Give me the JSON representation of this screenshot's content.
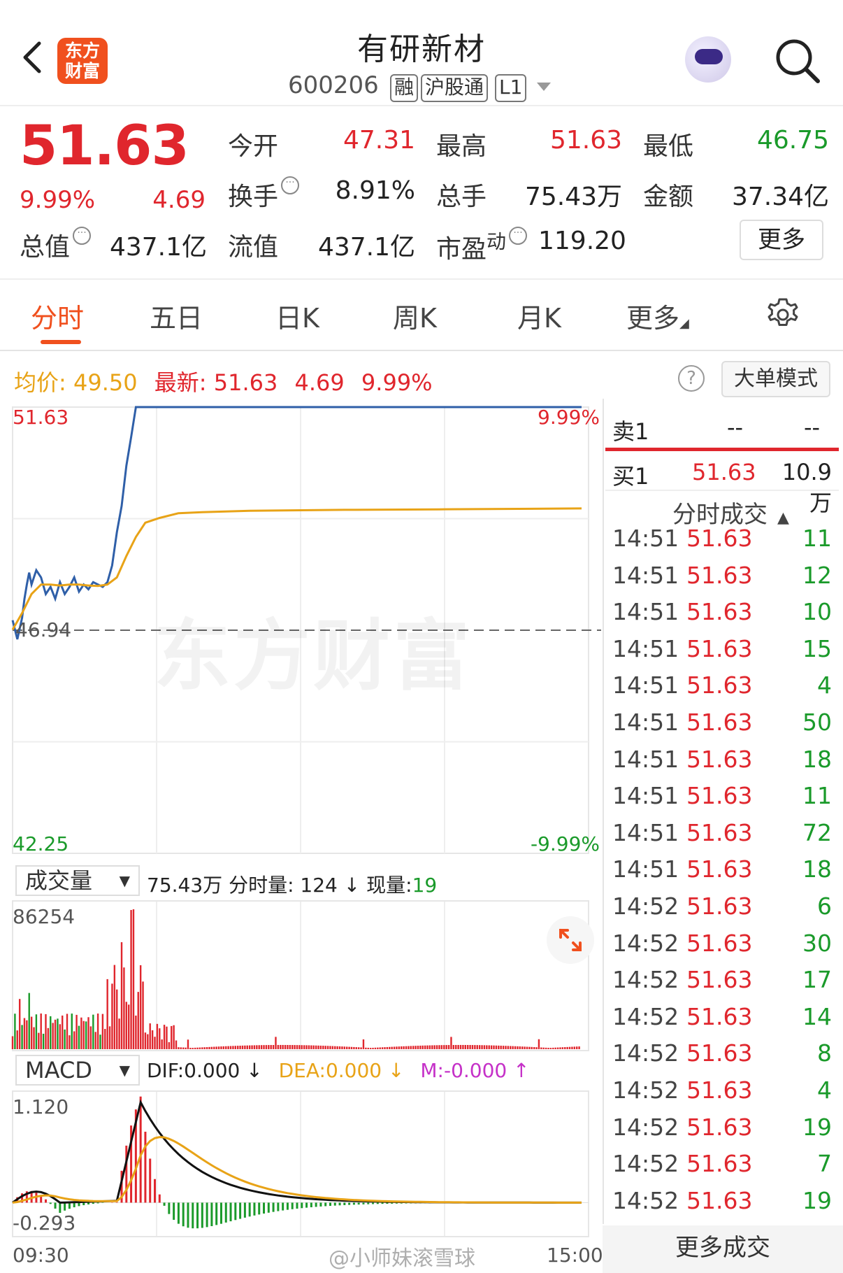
{
  "header": {
    "logo_line1": "东方",
    "logo_line2": "财富",
    "title": "有研新材",
    "code": "600206",
    "tags": [
      "融",
      "沪股通",
      "L1"
    ]
  },
  "quote": {
    "price": "51.63",
    "pct": "9.99%",
    "change": "4.69",
    "rows": [
      [
        {
          "label": "今开",
          "value": "47.31",
          "color": "red"
        },
        {
          "label": "最高",
          "value": "51.63",
          "color": "red"
        },
        {
          "label": "最低",
          "value": "46.75",
          "color": "green"
        }
      ],
      [
        {
          "label": "换手",
          "value": "8.91%",
          "color": "black"
        },
        {
          "label": "总手",
          "value": "75.43万",
          "color": "black"
        },
        {
          "label": "金额",
          "value": "37.34亿",
          "color": "black"
        }
      ],
      [
        {
          "label": "流值",
          "value": "437.1亿",
          "color": "black"
        },
        {
          "label": "市盈",
          "value": "119.20",
          "color": "black"
        }
      ]
    ],
    "total_value_label": "总值",
    "total_value": "437.1亿",
    "pe_sup": "动",
    "more_button": "更多"
  },
  "tabs": [
    "分时",
    "五日",
    "日K",
    "周K",
    "月K",
    "更多"
  ],
  "info": {
    "avg_label": "均价:",
    "avg_value": "49.50",
    "latest_label": "最新:",
    "latest_value": "51.63",
    "latest_change": "4.69",
    "latest_pct": "9.99%",
    "help": "?",
    "big_order_mode": "大单模式"
  },
  "chart_labels": {
    "price_high": "51.63",
    "pct_high": "9.99%",
    "pre_close": "46.94",
    "price_low": "42.25",
    "pct_low": "-9.99%",
    "volume_selector": "成交量",
    "volume_total": "75.43万",
    "min_vol_label": "分时量:",
    "min_vol_value": "124",
    "cur_vol_label": "现量:",
    "cur_vol_value": "19",
    "vol_max": "86254",
    "macd_selector": "MACD",
    "dif": "DIF:0.000",
    "dea": "DEA:0.000",
    "m": "M:-0.000",
    "macd_max": "1.120",
    "macd_min": "-0.293",
    "time_start": "09:30",
    "time_end": "15:00",
    "watermark": "东方财富",
    "credit": "@小师妹滚雪球"
  },
  "chart_data": {
    "type": "line",
    "title": "",
    "ylim": [
      42.25,
      51.63
    ],
    "pre_close": 46.94,
    "x_range": [
      "09:30",
      "15:00"
    ],
    "series": [
      {
        "name": "最新",
        "color": "#2f5fa8",
        "x": [
          0,
          2,
          4,
          5,
          6,
          7,
          8,
          10,
          12,
          14,
          16,
          18,
          20,
          22,
          24,
          26,
          28,
          30,
          32,
          34,
          36,
          38,
          40,
          42,
          44,
          46,
          48,
          50,
          52,
          60,
          120,
          180,
          240
        ],
        "y": [
          47.15,
          46.75,
          47.2,
          47.6,
          47.9,
          48.15,
          47.9,
          48.2,
          48.05,
          47.7,
          47.85,
          47.6,
          47.95,
          47.7,
          47.85,
          48.05,
          47.75,
          47.9,
          47.8,
          47.95,
          47.9,
          47.85,
          47.95,
          48.3,
          49.0,
          49.55,
          50.4,
          51.0,
          51.63,
          51.63,
          51.63,
          51.63,
          51.63
        ]
      },
      {
        "name": "均价",
        "color": "#e8a317",
        "x": [
          0,
          4,
          8,
          12,
          16,
          20,
          24,
          28,
          32,
          36,
          40,
          44,
          48,
          52,
          56,
          62,
          70,
          80,
          100,
          140,
          180,
          240
        ],
        "y": [
          46.95,
          47.3,
          47.7,
          47.9,
          47.9,
          47.88,
          47.9,
          47.9,
          47.88,
          47.87,
          47.9,
          48.05,
          48.5,
          48.9,
          49.2,
          49.3,
          49.4,
          49.42,
          49.45,
          49.47,
          49.48,
          49.5
        ]
      }
    ],
    "volume_max": 86254,
    "macd_range": [
      -0.293,
      1.12
    ]
  },
  "right_panel": {
    "sell1_label": "卖1",
    "sell1_price": "--",
    "sell1_vol": "--",
    "buy1_label": "买1",
    "buy1_price": "51.63",
    "buy1_vol": "10.9万",
    "trades_title": "分时成交",
    "trades": [
      {
        "time": "14:51",
        "price": "51.63",
        "vol": "11"
      },
      {
        "time": "14:51",
        "price": "51.63",
        "vol": "12"
      },
      {
        "time": "14:51",
        "price": "51.63",
        "vol": "10"
      },
      {
        "time": "14:51",
        "price": "51.63",
        "vol": "15"
      },
      {
        "time": "14:51",
        "price": "51.63",
        "vol": "4"
      },
      {
        "time": "14:51",
        "price": "51.63",
        "vol": "50"
      },
      {
        "time": "14:51",
        "price": "51.63",
        "vol": "18"
      },
      {
        "time": "14:51",
        "price": "51.63",
        "vol": "11"
      },
      {
        "time": "14:51",
        "price": "51.63",
        "vol": "72"
      },
      {
        "time": "14:51",
        "price": "51.63",
        "vol": "18"
      },
      {
        "time": "14:52",
        "price": "51.63",
        "vol": "6"
      },
      {
        "time": "14:52",
        "price": "51.63",
        "vol": "30"
      },
      {
        "time": "14:52",
        "price": "51.63",
        "vol": "17"
      },
      {
        "time": "14:52",
        "price": "51.63",
        "vol": "14"
      },
      {
        "time": "14:52",
        "price": "51.63",
        "vol": "8"
      },
      {
        "time": "14:52",
        "price": "51.63",
        "vol": "4"
      },
      {
        "time": "14:52",
        "price": "51.63",
        "vol": "19"
      },
      {
        "time": "14:52",
        "price": "51.63",
        "vol": "7"
      },
      {
        "time": "14:52",
        "price": "51.63",
        "vol": "19"
      }
    ],
    "more_trades": "更多成交"
  },
  "colors": {
    "up": "#e0262d",
    "down": "#1a9a2a",
    "accent": "#f0501e",
    "avg": "#e8a317",
    "price_line": "#2f5fa8"
  }
}
